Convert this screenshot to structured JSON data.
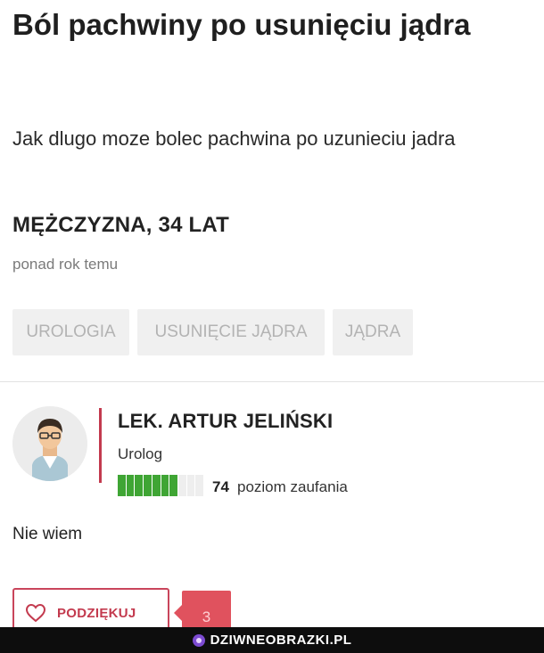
{
  "question": {
    "title": "Ból pachwiny po usunięciu jądra",
    "body": "Jak dlugo moze bolec pachwina po uzunieciu jadra",
    "author": "MĘŻCZYZNA, 34 LAT",
    "time": "ponad rok temu",
    "tags": [
      "UROLOGIA",
      "USUNIĘCIE JĄDRA",
      "JĄDRA"
    ]
  },
  "answer": {
    "doctor_name": "LEK. ARTUR JELIŃSKI",
    "specialty": "Urolog",
    "trust_score": "74",
    "trust_label": "poziom zaufania",
    "trust_fraction": 0.74,
    "text": "Nie wiem",
    "thanks_label": "PODZIĘKUJ",
    "thanks_count": "3"
  },
  "watermark": {
    "text": "DZIWNEOBRAZKI.PL"
  },
  "colors": {
    "accent": "#c33a4e",
    "count_bg": "#e0525e",
    "trust_green": "#3fa534",
    "tag_bg": "#f0f0f0"
  },
  "icons": {
    "avatar": "doctor-avatar-icon",
    "thanks": "heart-icon",
    "watermark": "watermark-logo-icon"
  }
}
